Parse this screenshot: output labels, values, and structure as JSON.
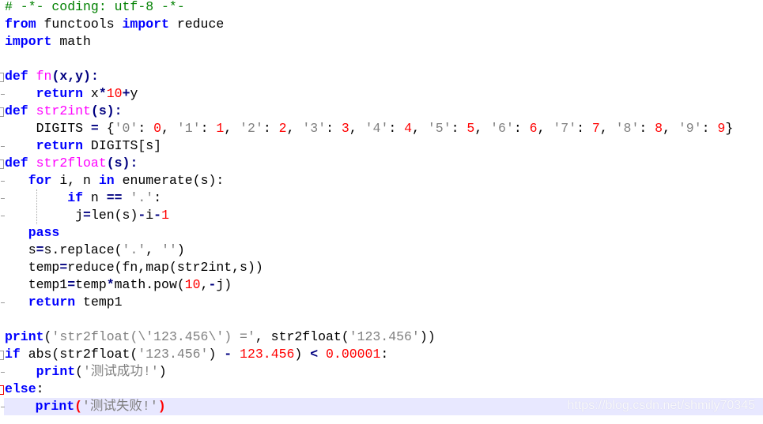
{
  "editor": {
    "current_line": 23,
    "colors": {
      "keyword": "#0000ff",
      "function": "#ff00ff",
      "number": "#ff0000",
      "string": "#808080",
      "comment": "#008000",
      "current_line_bg": "#e8e8ff"
    },
    "lines": [
      [
        [
          "# -*- coding: utf-8 -*-",
          "cm"
        ]
      ],
      [
        [
          "from",
          "kw"
        ],
        [
          " functools ",
          ""
        ],
        [
          "import",
          "kw"
        ],
        [
          " reduce",
          ""
        ]
      ],
      [
        [
          "import",
          "kw"
        ],
        [
          " math",
          ""
        ]
      ],
      [],
      [
        [
          "def",
          "kw"
        ],
        [
          " ",
          ""
        ],
        [
          "fn",
          "fn"
        ],
        [
          "(x,y):",
          "op"
        ]
      ],
      [
        [
          "    ",
          ""
        ],
        [
          "return",
          "kw"
        ],
        [
          " x",
          ""
        ],
        [
          "*",
          "op"
        ],
        [
          "10",
          "num"
        ],
        [
          "+",
          "op"
        ],
        [
          "y",
          ""
        ]
      ],
      [
        [
          "def",
          "kw"
        ],
        [
          " ",
          ""
        ],
        [
          "str2int",
          "fn"
        ],
        [
          "(s):",
          "op"
        ]
      ],
      [
        [
          "    DIGITS ",
          ""
        ],
        [
          "=",
          "op"
        ],
        [
          " {",
          ""
        ],
        [
          "'0'",
          "str"
        ],
        [
          ": ",
          ""
        ],
        [
          "0",
          "num"
        ],
        [
          ", ",
          ""
        ],
        [
          "'1'",
          "str"
        ],
        [
          ": ",
          ""
        ],
        [
          "1",
          "num"
        ],
        [
          ", ",
          ""
        ],
        [
          "'2'",
          "str"
        ],
        [
          ": ",
          ""
        ],
        [
          "2",
          "num"
        ],
        [
          ", ",
          ""
        ],
        [
          "'3'",
          "str"
        ],
        [
          ": ",
          ""
        ],
        [
          "3",
          "num"
        ],
        [
          ", ",
          ""
        ],
        [
          "'4'",
          "str"
        ],
        [
          ": ",
          ""
        ],
        [
          "4",
          "num"
        ],
        [
          ", ",
          ""
        ],
        [
          "'5'",
          "str"
        ],
        [
          ": ",
          ""
        ],
        [
          "5",
          "num"
        ],
        [
          ", ",
          ""
        ],
        [
          "'6'",
          "str"
        ],
        [
          ": ",
          ""
        ],
        [
          "6",
          "num"
        ],
        [
          ", ",
          ""
        ],
        [
          "'7'",
          "str"
        ],
        [
          ": ",
          ""
        ],
        [
          "7",
          "num"
        ],
        [
          ", ",
          ""
        ],
        [
          "'8'",
          "str"
        ],
        [
          ": ",
          ""
        ],
        [
          "8",
          "num"
        ],
        [
          ", ",
          ""
        ],
        [
          "'9'",
          "str"
        ],
        [
          ": ",
          ""
        ],
        [
          "9",
          "num"
        ],
        [
          "}",
          ""
        ]
      ],
      [
        [
          "    ",
          ""
        ],
        [
          "return",
          "kw"
        ],
        [
          " DIGITS[s]",
          ""
        ]
      ],
      [
        [
          "def",
          "kw"
        ],
        [
          " ",
          ""
        ],
        [
          "str2float",
          "fn"
        ],
        [
          "(s):",
          "op"
        ]
      ],
      [
        [
          "   ",
          ""
        ],
        [
          "for",
          "kw"
        ],
        [
          " i, n ",
          ""
        ],
        [
          "in",
          "kw"
        ],
        [
          " enumerate(s):",
          ""
        ]
      ],
      [
        [
          "        ",
          ""
        ],
        [
          "if",
          "kw"
        ],
        [
          " n ",
          ""
        ],
        [
          "==",
          "op"
        ],
        [
          " ",
          ""
        ],
        [
          "'.'",
          "str"
        ],
        [
          ":",
          ""
        ]
      ],
      [
        [
          "         j",
          ""
        ],
        [
          "=",
          "op"
        ],
        [
          "len(s)",
          ""
        ],
        [
          "-",
          "op"
        ],
        [
          "i",
          ""
        ],
        [
          "-",
          "op"
        ],
        [
          "1",
          "num"
        ]
      ],
      [
        [
          "   ",
          ""
        ],
        [
          "pass",
          "kw"
        ]
      ],
      [
        [
          "   s",
          ""
        ],
        [
          "=",
          "op"
        ],
        [
          "s.replace(",
          ""
        ],
        [
          "'.'",
          "str"
        ],
        [
          ", ",
          ""
        ],
        [
          "''",
          "str"
        ],
        [
          ")",
          ""
        ]
      ],
      [
        [
          "   temp",
          ""
        ],
        [
          "=",
          "op"
        ],
        [
          "reduce(fn,map(str2int,s))",
          ""
        ]
      ],
      [
        [
          "   temp1",
          ""
        ],
        [
          "=",
          "op"
        ],
        [
          "temp",
          ""
        ],
        [
          "*",
          "op"
        ],
        [
          "math.pow(",
          ""
        ],
        [
          "10",
          "num"
        ],
        [
          ",",
          ""
        ],
        [
          "-",
          "op"
        ],
        [
          "j)",
          ""
        ]
      ],
      [
        [
          "   ",
          ""
        ],
        [
          "return",
          "kw"
        ],
        [
          " temp1",
          ""
        ]
      ],
      [],
      [
        [
          "print",
          "kw"
        ],
        [
          "(",
          ""
        ],
        [
          "'str2float(\\'123.456\\') ='",
          "str"
        ],
        [
          ", str2float(",
          ""
        ],
        [
          "'123.456'",
          "str"
        ],
        [
          "))",
          ""
        ]
      ],
      [
        [
          "if",
          "kw"
        ],
        [
          " abs(str2float(",
          ""
        ],
        [
          "'123.456'",
          "str"
        ],
        [
          ") ",
          ""
        ],
        [
          "-",
          "op"
        ],
        [
          " ",
          ""
        ],
        [
          "123.456",
          "num"
        ],
        [
          ") ",
          ""
        ],
        [
          "<",
          "op"
        ],
        [
          " ",
          ""
        ],
        [
          "0.00001",
          "num"
        ],
        [
          ":",
          ""
        ]
      ],
      [
        [
          "    ",
          ""
        ],
        [
          "print",
          "kw"
        ],
        [
          "(",
          ""
        ],
        [
          "'测试成功!'",
          "str"
        ],
        [
          ")",
          ""
        ]
      ],
      [
        [
          "else",
          "kw"
        ],
        [
          ":",
          ""
        ]
      ],
      [
        [
          "    ",
          ""
        ],
        [
          "print",
          "kw"
        ],
        [
          "(",
          "br"
        ],
        [
          "'测试失败!'",
          "str"
        ],
        [
          ")",
          "br"
        ]
      ]
    ]
  },
  "watermark": "https://blog.csdn.net/shmily70345"
}
